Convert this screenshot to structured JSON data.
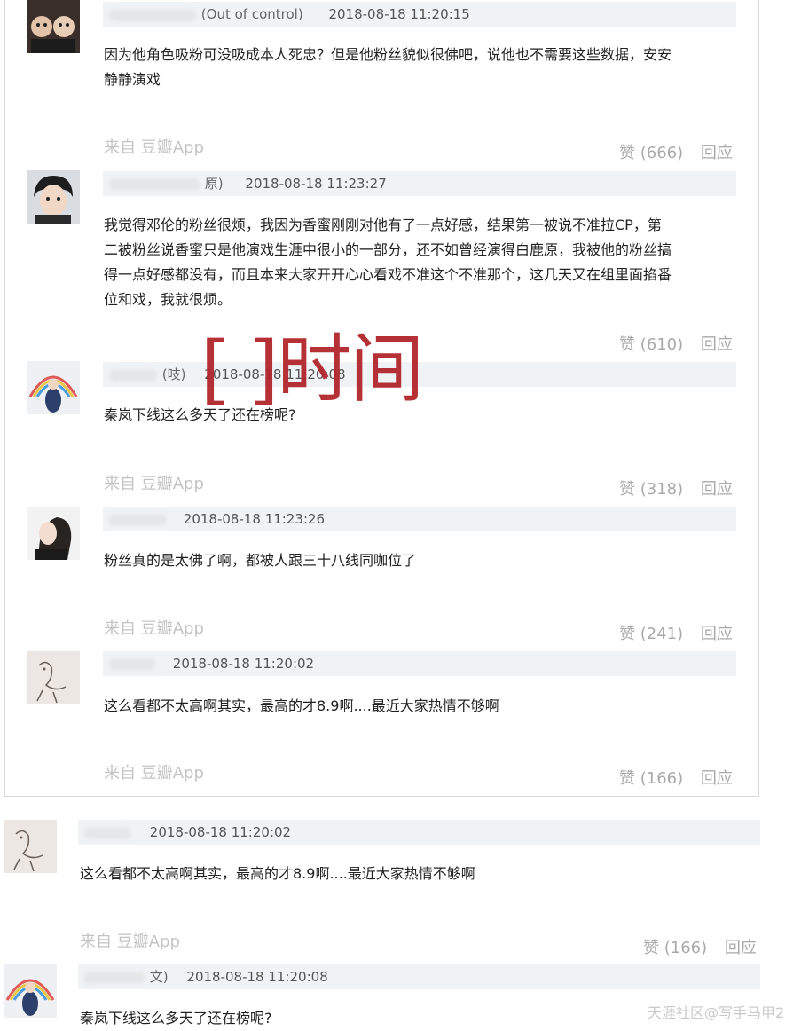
{
  "comments": [
    {
      "tag": "(Out of control)",
      "time": "2018-08-18 11:20:15",
      "text_lines": [
        "因为他角色吸粉可没吸成本人死忠？但是他粉丝貌似很佛吧，说他也不需要这些数据，安安",
        "静静演戏"
      ],
      "source": "来自  豆瓣App",
      "likes": "赞 (666)",
      "reply": "回应"
    },
    {
      "tag": "原)",
      "time": "2018-08-18 11:23:27",
      "text_lines": [
        "我觉得邓伦的粉丝很烦，我因为香蜜刚刚对他有了一点好感，结果第一被说不准拉CP，第",
        "二被粉丝说香蜜只是他演戏生涯中很小的一部分，还不如曾经演得白鹿原，我被他的粉丝搞",
        "得一点好感都没有，而且本来大家开开心心看戏不准这个不准那个，这几天又在组里面掐番",
        "位和戏，我就很烦。"
      ],
      "likes": "赞 (610)",
      "reply": "回应"
    },
    {
      "tag": "(吱)",
      "time": "2018-08-18 11:20:08",
      "text_lines": [
        "秦岚下线这么多天了还在榜呢?"
      ],
      "source": "来自  豆瓣App",
      "likes": "赞 (318)",
      "reply": "回应"
    },
    {
      "tag": "",
      "time": "2018-08-18 11:23:26",
      "text_lines": [
        "粉丝真的是太佛了啊，都被人跟三十八线同咖位了"
      ],
      "source": "来自  豆瓣App",
      "likes": "赞 (241)",
      "reply": "回应"
    },
    {
      "tag": "",
      "time": "2018-08-18 11:20:02",
      "text_lines": [
        "这么看都不太高啊其实，最高的才8.9啊....最近大家热情不够啊"
      ],
      "source": "来自  豆瓣App",
      "likes": "赞 (166)",
      "reply": "回应"
    }
  ],
  "outside": [
    {
      "tag": "",
      "time": "2018-08-18 11:20:02",
      "text_lines": [
        "这么看都不太高啊其实，最高的才8.9啊....最近大家热情不够啊"
      ],
      "source": "来自  豆瓣App",
      "likes": "赞 (166)",
      "reply": "回应"
    },
    {
      "tag": "文)",
      "time": "2018-08-18 11:20:08",
      "text_lines": [
        "秦岚下线这么多天了还在榜呢?"
      ]
    }
  ],
  "stamp": "[   ]时间",
  "watermark": "天涯社区@写手马甲2"
}
